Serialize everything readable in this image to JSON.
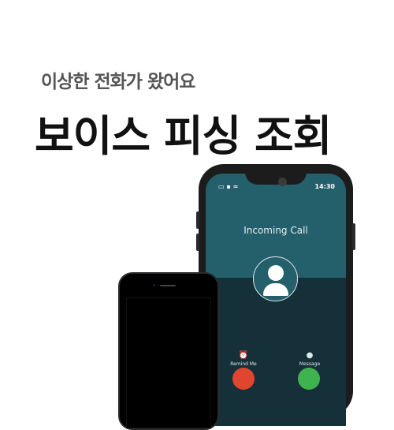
{
  "subtitle": "이상한 전화가 왔어요",
  "title": "보이스 피싱 조회",
  "phone": {
    "time": "14:30",
    "incoming_label": "Incoming Call",
    "actions": [
      {
        "label": "Remind Me",
        "icon": "alarm-clock-icon"
      },
      {
        "label": "Message",
        "icon": "message-bubble-icon"
      }
    ],
    "decline_color": "#e0452f",
    "accept_color": "#3fb34f"
  }
}
